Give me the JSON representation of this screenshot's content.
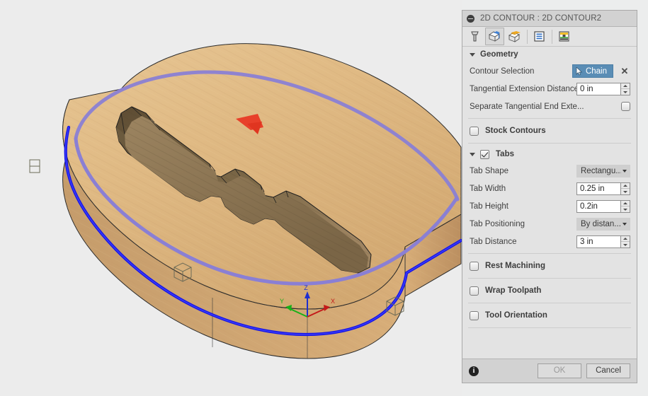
{
  "panel": {
    "title": "2D CONTOUR : 2D CONTOUR2",
    "collapse_icon": "minus-circle-icon",
    "tabs": [
      {
        "name": "tool",
        "icon": "endmill-tool-icon",
        "active": false
      },
      {
        "name": "geometry",
        "icon": "geometry-box-icon",
        "active": true
      },
      {
        "name": "heights",
        "icon": "heights-box-icon",
        "active": false
      },
      {
        "name": "passes",
        "icon": "passes-icon",
        "active": false
      },
      {
        "name": "linking",
        "icon": "linking-icon",
        "active": false
      }
    ],
    "geometry": {
      "header": "Geometry",
      "contour_selection": {
        "label": "Contour Selection",
        "button_label": "Chain",
        "button_icon": "cursor-arrow-icon",
        "clear_icon": "close-x-icon"
      },
      "tangential_extension": {
        "label": "Tangential Extension Distance",
        "value": "0 in"
      },
      "separate_tangential": {
        "label": "Separate Tangential End Exte...",
        "checked": false
      }
    },
    "stock_contours": {
      "label": "Stock Contours",
      "checked": false
    },
    "tabs_section": {
      "header": "Tabs",
      "checked": true,
      "tab_shape": {
        "label": "Tab Shape",
        "value": "Rectangu...",
        "arrow_icon": "chevron-down-icon"
      },
      "tab_width": {
        "label": "Tab Width",
        "value": "0.25 in"
      },
      "tab_height": {
        "label": "Tab Height",
        "value": "0.2in"
      },
      "tab_positioning": {
        "label": "Tab Positioning",
        "value": "By distan...",
        "arrow_icon": "chevron-down-icon"
      },
      "tab_distance": {
        "label": "Tab Distance",
        "value": "3 in"
      }
    },
    "rest_machining": {
      "label": "Rest Machining",
      "checked": false
    },
    "wrap_toolpath": {
      "label": "Wrap Toolpath",
      "checked": false
    },
    "tool_orientation": {
      "label": "Tool Orientation",
      "checked": false
    },
    "footer": {
      "info_icon": "info-icon",
      "info_glyph": "i",
      "ok_label": "OK",
      "cancel_label": "Cancel"
    }
  },
  "viewport": {
    "model_name": "wood-stock-block",
    "toolpath_color": "#8a7fd4",
    "selected_contour_color": "#1414e6",
    "direction_arrow_color": "#e8402a",
    "stock_top_color": "#e0bb85",
    "stock_side_color": "#c9a273",
    "background_color": "#ececec",
    "axes": {
      "z_label": "Z",
      "x_label": "X",
      "y_label": "Y",
      "z_color": "#1e2fd0",
      "x_color": "#c41a1a",
      "y_color": "#18b018"
    },
    "tab_markers": 3,
    "tab_marker_name": "tab-cube-marker"
  }
}
